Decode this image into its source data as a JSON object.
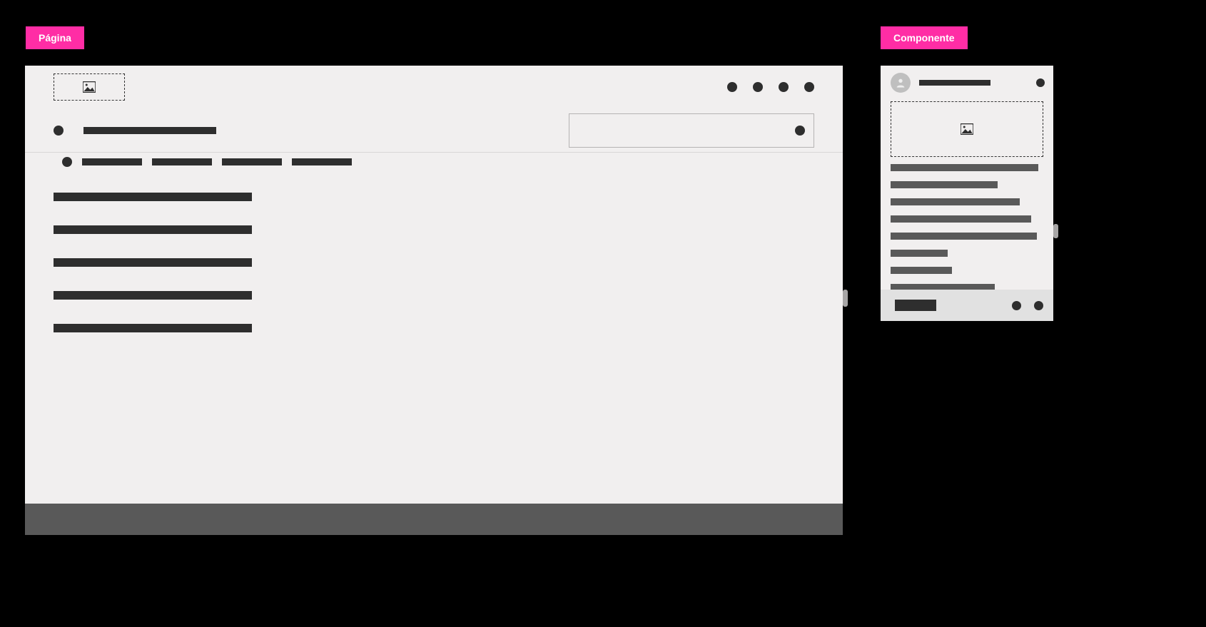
{
  "tags": {
    "page": "Página",
    "component": "Componente"
  },
  "page": {
    "logo_icon": "image-icon",
    "top_actions": [
      "dot",
      "dot",
      "dot",
      "dot"
    ],
    "title_bullet": "dot",
    "title_bar": "bar",
    "search_icon": "search-dot",
    "subnav": {
      "bullet": "dot",
      "items": [
        "bar",
        "bar",
        "bar",
        "bar"
      ]
    },
    "content_lines": [
      "bar",
      "bar",
      "bar",
      "bar",
      "bar"
    ],
    "footer": "footer"
  },
  "component": {
    "avatar_icon": "avatar",
    "header_bar": "bar",
    "header_action_icon": "dot",
    "image_icon": "image-icon",
    "body_lines_widths": [
      "207px",
      "150px",
      "181px",
      "197px",
      "205px",
      "80px",
      "86px",
      "146px"
    ],
    "button": "button",
    "footer_actions": [
      "dot",
      "dot"
    ]
  },
  "colors": {
    "accent": "#FF2DA5",
    "dark": "#2E2E2E",
    "medium": "#595959",
    "panel": "#F1EFEF"
  }
}
